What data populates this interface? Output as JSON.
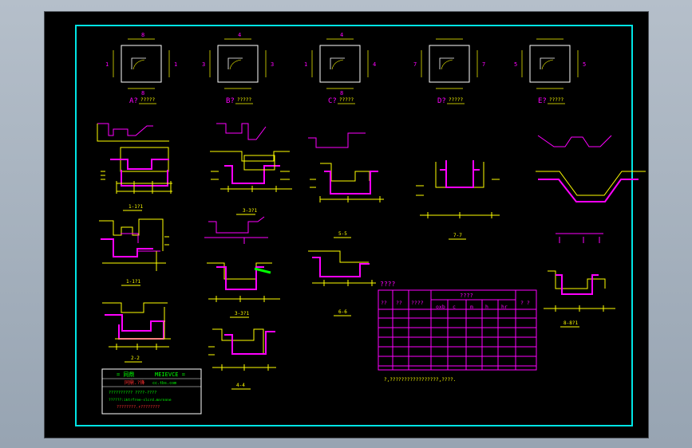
{
  "colors": {
    "background": "#000000",
    "frame": "#00e5e5",
    "wall": "#ff00ff",
    "dim": "#ffff00",
    "rebar": "#ff00ff",
    "text_cyan": "#00ffff",
    "white": "#ffffff",
    "green": "#00ff00",
    "red": "#ff3030"
  },
  "plans": [
    {
      "label": "A?",
      "top": "8",
      "bottom": "8",
      "left": "1",
      "right": "1"
    },
    {
      "label": "B?",
      "top": "4",
      "bottom": "",
      "left": "3",
      "right": "3"
    },
    {
      "label": "C?",
      "top": "4",
      "bottom": "8",
      "left": "1",
      "right": "4"
    },
    {
      "label": "D?",
      "top": "",
      "bottom": "",
      "left": "7",
      "right": "7"
    },
    {
      "label": "E?",
      "top": "",
      "bottom": "",
      "left": "5",
      "right": "5"
    }
  ],
  "plan_captions": [
    "?????",
    "?????",
    "?????",
    "?????",
    "?????"
  ],
  "section_labels": [
    "1-1?1",
    "1-1?1",
    "2-2",
    "3-3?1",
    "3-3?1",
    "4-4",
    "5-5",
    "6-6",
    "7-7",
    "8-8?1"
  ],
  "table": {
    "title": "????",
    "headers": [
      "??",
      "??",
      "????",
      "????",
      "oxb",
      "c",
      "m",
      "h",
      "hr",
      "? ?"
    ],
    "rows": 7
  },
  "table_note": "?,?????????????????,????.",
  "title_block": {
    "line1_a": "= 同鼎",
    "line1_b": "MEIEVCE =",
    "line2_a": "同鼎.?锋",
    "line2_b": "cc.tbs.com",
    "line3": "?????????? ????-????",
    "line4": "??????:iktrfree-slcrd.mnrnnne",
    "line5": "????????.r????????"
  }
}
